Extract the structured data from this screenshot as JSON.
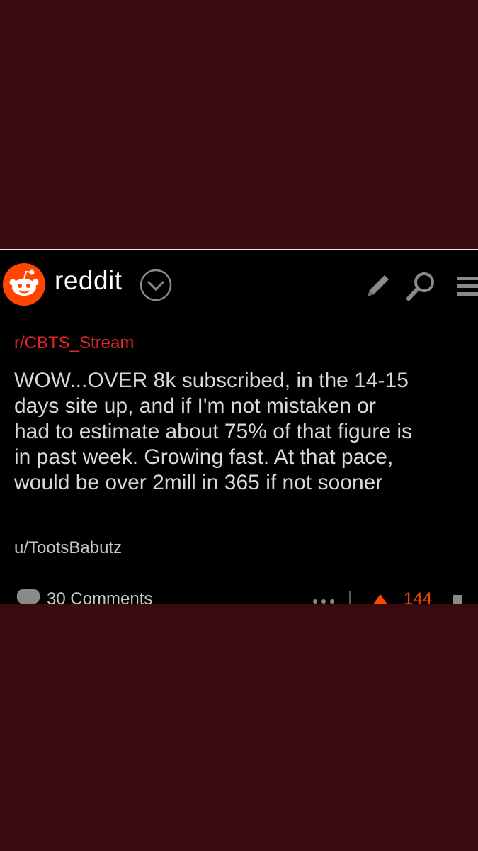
{
  "app": {
    "name": "reddit",
    "brand_color": "#ff4500",
    "icons": [
      "reddit-snoo-icon",
      "chevron-down-icon",
      "pencil-icon",
      "search-icon",
      "menu-icon"
    ]
  },
  "post": {
    "subreddit": "r/CBTS_Stream",
    "title": "WOW...OVER 8k subscribed, in the 14-15\ndays site up, and if I'm not mistaken or\nhad to estimate about 75% of that figure is\nin past week. Growing fast. At that pace,\nwould be over 2mill in 365 if not sooner",
    "author": "u/TootsBabutz",
    "comments_label": "30 Comments",
    "score": "144"
  }
}
